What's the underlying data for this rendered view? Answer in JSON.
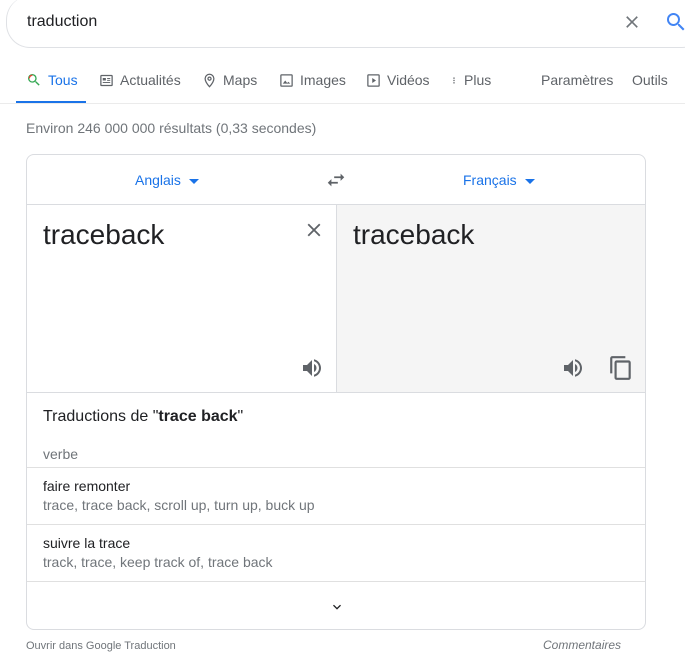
{
  "search": {
    "query": "traduction"
  },
  "tabs": [
    {
      "label": "Tous",
      "icon": "search-icon",
      "active": true
    },
    {
      "label": "Actualités",
      "icon": "news-icon"
    },
    {
      "label": "Maps",
      "icon": "map-pin-icon"
    },
    {
      "label": "Images",
      "icon": "image-icon"
    },
    {
      "label": "Vidéos",
      "icon": "video-icon"
    },
    {
      "label": "Plus",
      "icon": "more-vert-icon"
    }
  ],
  "tools": {
    "settings": "Paramètres",
    "tools": "Outils"
  },
  "stats": "Environ 246 000 000 résultats (0,33 secondes)",
  "translator": {
    "source_lang": "Anglais",
    "target_lang": "Français",
    "source_text": "traceback",
    "target_text": "traceback"
  },
  "dictionary": {
    "title_prefix": "Traductions de \"",
    "term": "trace back",
    "title_suffix": "\"",
    "part_of_speech": "verbe",
    "entries": [
      {
        "word": "faire remonter",
        "synonyms": "trace, trace back, scroll up, turn up, buck up"
      },
      {
        "word": "suivre la trace",
        "synonyms": "track, trace, keep track of, trace back"
      }
    ]
  },
  "footer": {
    "open_link": "Ouvrir dans Google Traduction",
    "feedback": "Commentaires"
  },
  "colors": {
    "accent": "#1a73e8",
    "muted": "#70757a",
    "border": "#dadce0"
  }
}
